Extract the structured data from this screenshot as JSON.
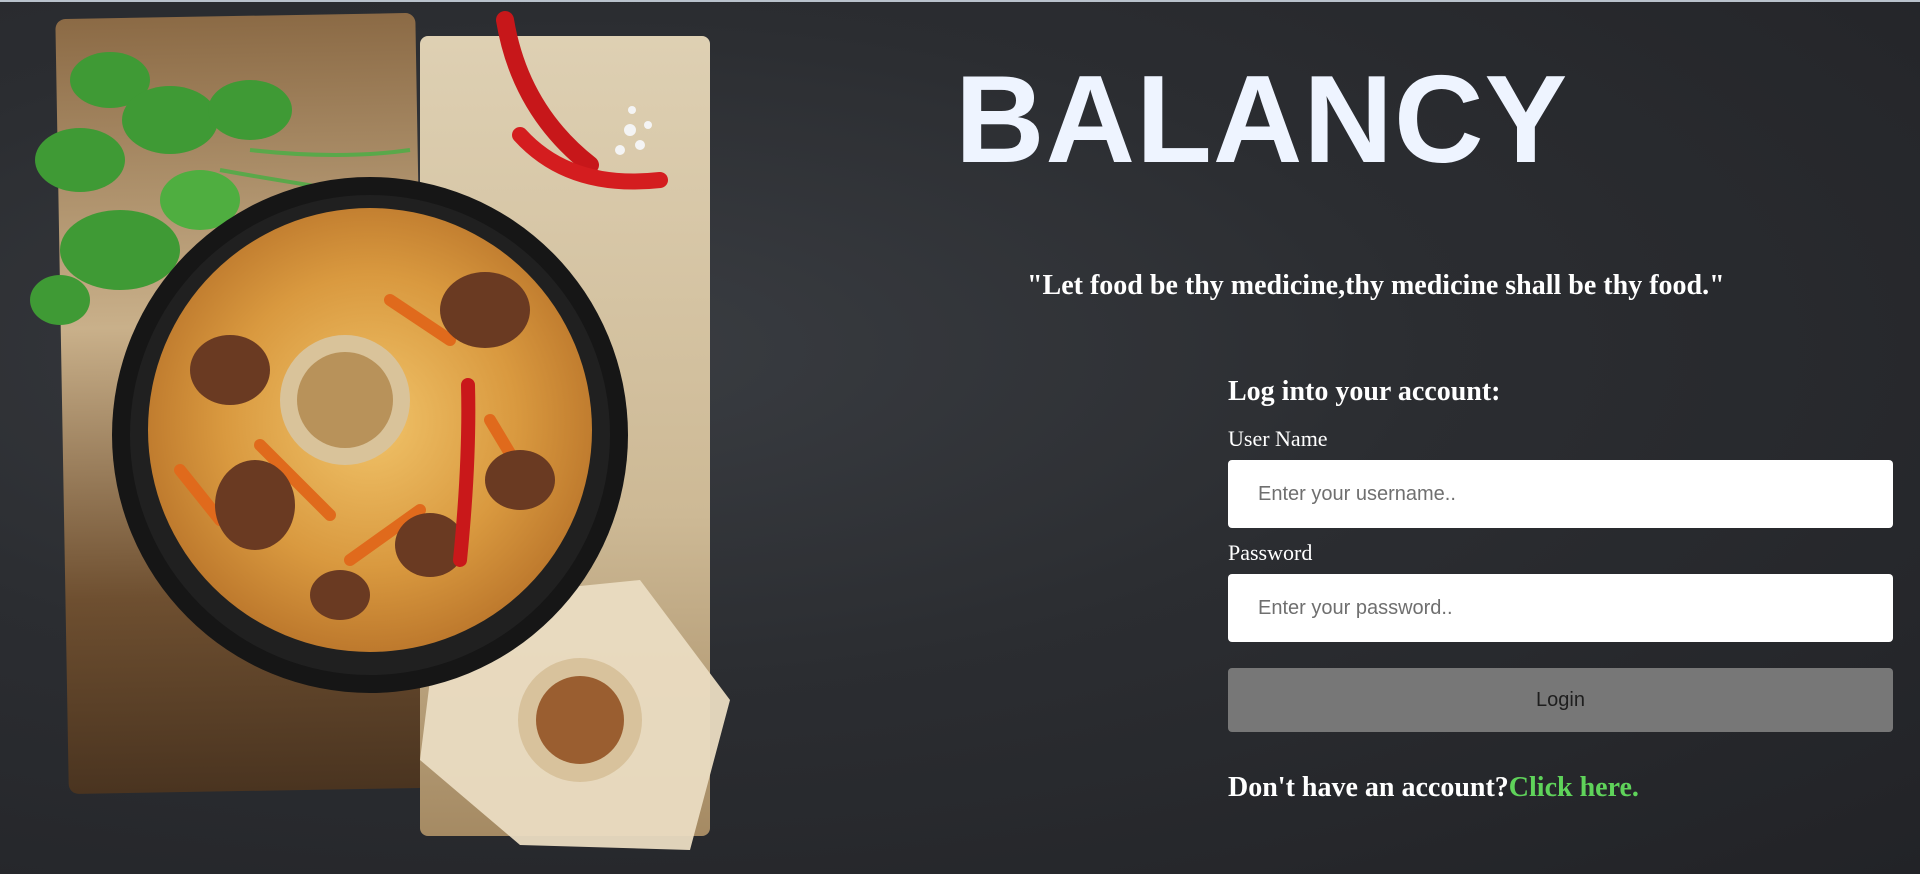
{
  "app": {
    "brand": "BALANCY",
    "quote": "\"Let food be thy medicine,thy medicine shall be thy food.\""
  },
  "login": {
    "heading": "Log into your account:",
    "username_label": "User Name",
    "username_placeholder": "Enter your username..",
    "password_label": "Password",
    "password_placeholder": "Enter your password..",
    "login_button": "Login",
    "signup_prompt": "Don't have an account?",
    "signup_link": "Click here."
  },
  "colors": {
    "background": "#2b2d31",
    "title": "#eef4ff",
    "link": "#5fd35a",
    "button": "#777777"
  },
  "icons": [
    "food-plate-illustration"
  ]
}
